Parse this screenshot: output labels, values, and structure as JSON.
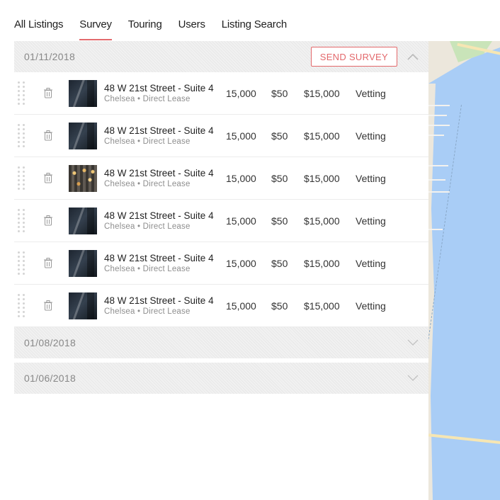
{
  "tabs": [
    {
      "label": "All Listings",
      "active": false
    },
    {
      "label": "Survey",
      "active": true
    },
    {
      "label": "Touring",
      "active": false
    },
    {
      "label": "Users",
      "active": false
    },
    {
      "label": "Listing Search",
      "active": false
    }
  ],
  "groups": [
    {
      "date": "01/11/2018",
      "expanded": true,
      "action_label": "SEND SURVEY"
    },
    {
      "date": "01/08/2018",
      "expanded": false
    },
    {
      "date": "01/06/2018",
      "expanded": false
    }
  ],
  "listings": [
    {
      "title": "48 W 21st Street - Suite 4",
      "subtitle": "Chelsea • Direct Lease",
      "sqft": "15,000",
      "rate": "$50",
      "total": "$15,000",
      "status": "Vetting",
      "thumb": "dark"
    },
    {
      "title": "48 W 21st Street - Suite 4",
      "subtitle": "Chelsea • Direct Lease",
      "sqft": "15,000",
      "rate": "$50",
      "total": "$15,000",
      "status": "Vetting",
      "thumb": "dark"
    },
    {
      "title": "48 W 21st Street - Suite 4",
      "subtitle": "Chelsea • Direct Lease",
      "sqft": "15,000",
      "rate": "$50",
      "total": "$15,000",
      "status": "Vetting",
      "thumb": "lit"
    },
    {
      "title": "48 W 21st Street - Suite 4",
      "subtitle": "Chelsea • Direct Lease",
      "sqft": "15,000",
      "rate": "$50",
      "total": "$15,000",
      "status": "Vetting",
      "thumb": "dark"
    },
    {
      "title": "48 W 21st Street - Suite 4",
      "subtitle": "Chelsea • Direct Lease",
      "sqft": "15,000",
      "rate": "$50",
      "total": "$15,000",
      "status": "Vetting",
      "thumb": "dark"
    },
    {
      "title": "48 W 21st Street - Suite 4",
      "subtitle": "Chelsea • Direct Lease",
      "sqft": "15,000",
      "rate": "$50",
      "total": "$15,000",
      "status": "Vetting",
      "thumb": "dark"
    }
  ],
  "colors": {
    "accent": "#e3686b",
    "map_water": "#a9cdf6"
  },
  "icons": {
    "drag": "drag-handle-icon",
    "delete": "trash-icon",
    "expand": "chevron-down-icon",
    "collapse": "chevron-up-icon"
  }
}
